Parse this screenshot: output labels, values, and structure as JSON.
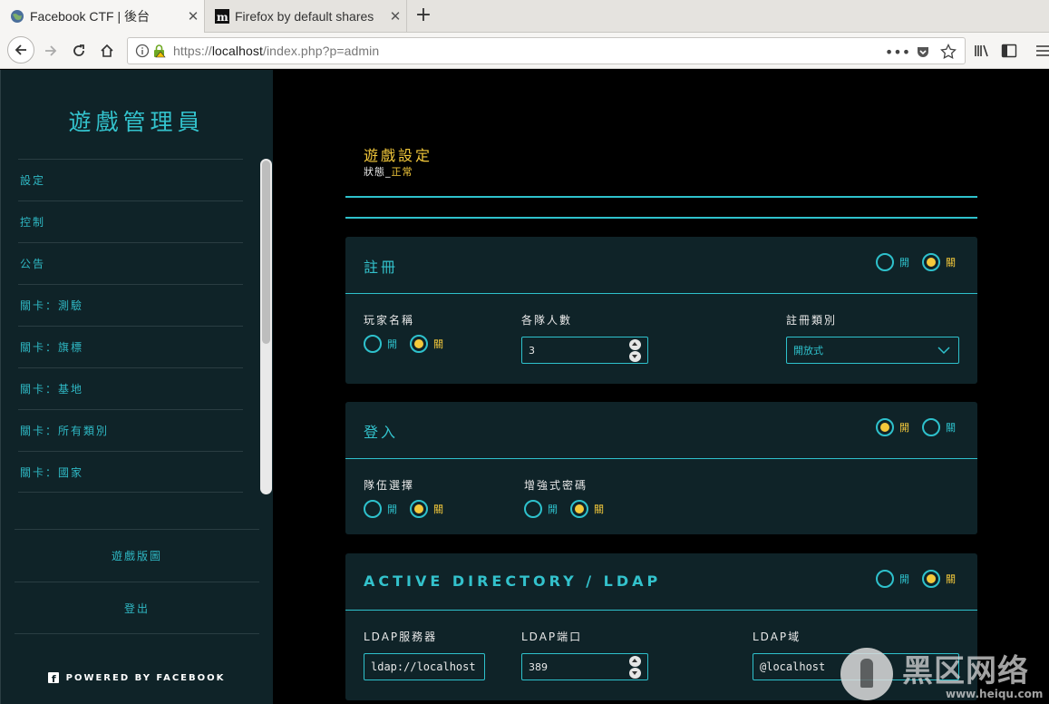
{
  "browser": {
    "tabs": [
      {
        "title": "Facebook CTF | 後台",
        "active": true
      },
      {
        "title": "Firefox by default shares",
        "active": false
      }
    ],
    "url_scheme": "https://",
    "url_host": "localhost",
    "url_path": "/index.php?p=admin"
  },
  "sidebar": {
    "title": "遊戲管理員",
    "items": [
      {
        "label": "設定"
      },
      {
        "label": "控制"
      },
      {
        "label": "公告"
      },
      {
        "label": "關卡：測驗"
      },
      {
        "label": "關卡：旗標"
      },
      {
        "label": "關卡：基地"
      },
      {
        "label": "關卡：所有類別"
      },
      {
        "label": "關卡：國家"
      }
    ],
    "bottom_links": [
      {
        "label": "遊戲版圖"
      },
      {
        "label": "登出"
      }
    ],
    "powered_by": "POWERED BY FACEBOOK"
  },
  "main": {
    "title": "遊戲設定",
    "status_label": "狀態_",
    "status_value": "正常",
    "registration": {
      "title": "註冊",
      "toggle": {
        "on_label": "開",
        "off_label": "關",
        "selected": "off"
      },
      "player_name": {
        "label": "玩家名稱",
        "on_label": "開",
        "off_label": "關",
        "selected": "off"
      },
      "team_size": {
        "label": "各隊人數",
        "value": "3"
      },
      "reg_type": {
        "label": "註冊類別",
        "value": "開放式"
      }
    },
    "login": {
      "title": "登入",
      "toggle": {
        "on_label": "開",
        "off_label": "關",
        "selected": "on"
      },
      "team_select": {
        "label": "隊伍選擇",
        "on_label": "開",
        "off_label": "關",
        "selected": "off"
      },
      "strong_password": {
        "label": "增強式密碼",
        "on_label": "開",
        "off_label": "關",
        "selected": "off"
      }
    },
    "ldap": {
      "title": "ACTIVE DIRECTORY / LDAP",
      "toggle": {
        "on_label": "開",
        "off_label": "關",
        "selected": "off"
      },
      "server": {
        "label": "LDAP服務器",
        "value": "ldap://localhost"
      },
      "port": {
        "label": "LDAP端口",
        "value": "389"
      },
      "domain": {
        "label": "LDAP域",
        "value": "@localhost"
      }
    }
  },
  "watermark": {
    "text": "黑区网络",
    "site": "www.heiqu.com"
  },
  "colors": {
    "accent": "#2ec1cc",
    "highlight": "#f4c93b",
    "panel": "#0f2328"
  }
}
